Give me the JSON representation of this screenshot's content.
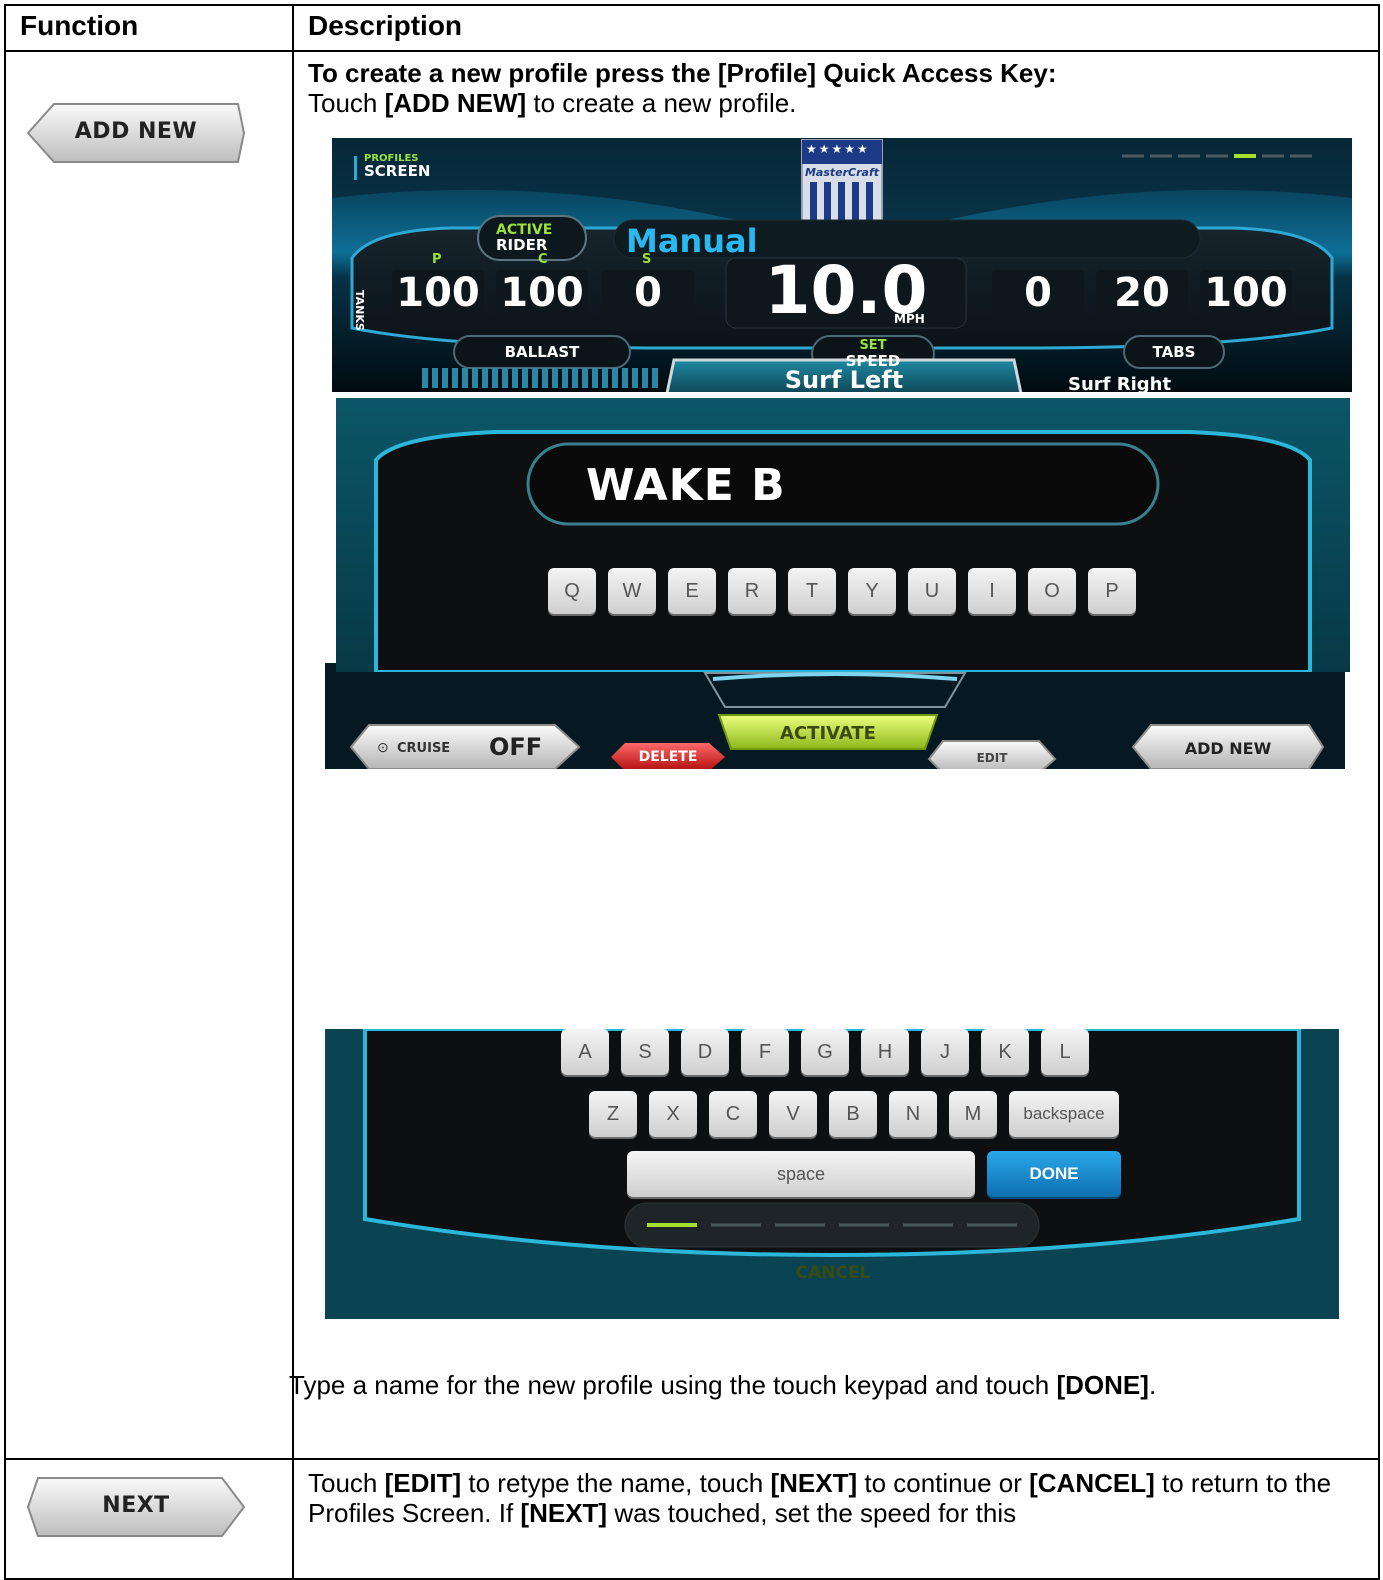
{
  "table": {
    "headers": {
      "function": "Function",
      "description": "Description"
    },
    "rows": [
      {
        "button_label": "ADD NEW",
        "heading": "To create a new profile press the [Profile] Quick Access Key:",
        "line1_pre": "Touch ",
        "line1_bold": "[ADD NEW]",
        "line1_post": " to create a new profile.",
        "footer_pre": "Type a name for the new profile using the touch keypad and touch ",
        "footer_bold": "[DONE]",
        "footer_post": "."
      },
      {
        "button_label": "NEXT",
        "t1": "Touch ",
        "b1": "[EDIT]",
        "t2": " to retype the name, touch ",
        "b2": "[NEXT]",
        "t3": " to continue or ",
        "b3": "[CANCEL]",
        "t4": " to return to the Profiles Screen. If ",
        "b4": "[NEXT]",
        "t5": " was touched, set the speed for this"
      }
    ]
  },
  "profiles_screen": {
    "title_small": "PROFILES",
    "title_big": "SCREEN",
    "brand": "MasterCraft",
    "active_label_top": "ACTIVE",
    "active_label_bottom": "RIDER",
    "rider_name": "Manual",
    "tanks_label": "TANKS",
    "tank_letters": [
      "P",
      "C",
      "S"
    ],
    "tank_values": [
      "100",
      "100",
      "0"
    ],
    "speed_value": "10.0",
    "speed_unit": "MPH",
    "tab_values": [
      "0",
      "20",
      "100"
    ],
    "ballast_label": "BALLAST",
    "set_speed_top": "SET",
    "set_speed_bottom": "SPEED",
    "tabs_label": "TABS",
    "surf_selected": "Surf Left",
    "surf_other": "Surf Right",
    "cruise_label": "CRUISE",
    "cruise_value": "OFF",
    "delete_label": "DELETE",
    "activate_label": "ACTIVATE",
    "edit_label": "EDIT",
    "add_new_label": "ADD NEW"
  },
  "keyboard_screen": {
    "entered_text": "WAKE B",
    "row1": [
      "Q",
      "W",
      "E",
      "R",
      "T",
      "Y",
      "U",
      "I",
      "O",
      "P"
    ],
    "row2": [
      "A",
      "S",
      "D",
      "F",
      "G",
      "H",
      "J",
      "K",
      "L"
    ],
    "row3": [
      "Z",
      "X",
      "C",
      "V",
      "B",
      "N",
      "M"
    ],
    "backspace_label": "backspace",
    "space_label": "space",
    "done_label": "DONE",
    "cancel_label": "CANCEL"
  }
}
